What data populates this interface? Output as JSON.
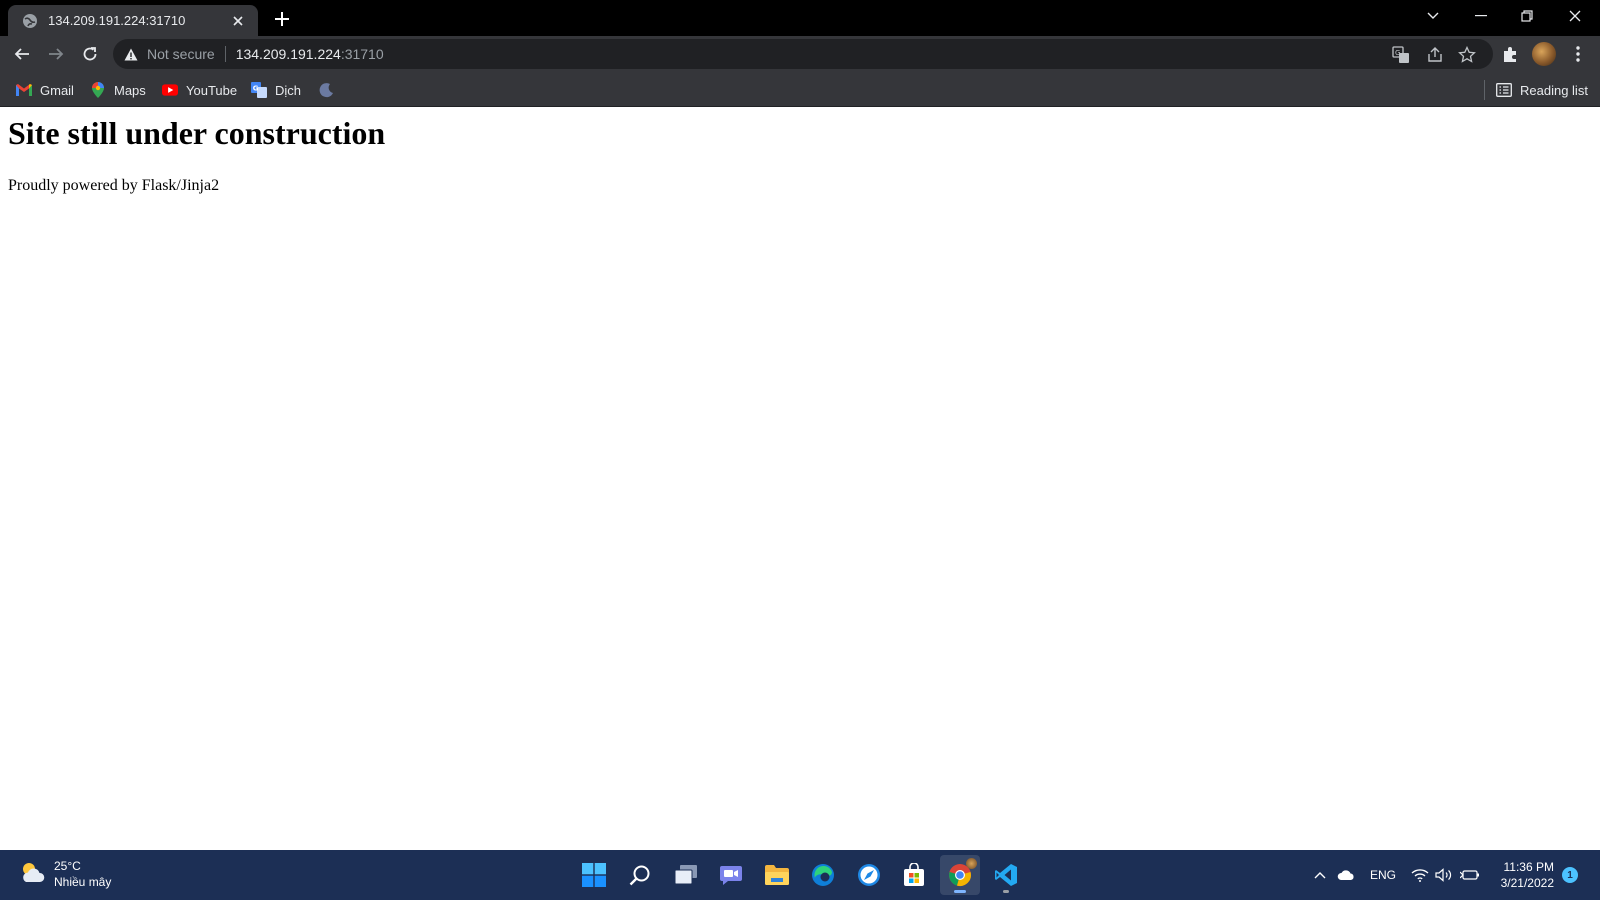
{
  "browser": {
    "tab": {
      "title": "134.209.191.224:31710"
    },
    "address_bar": {
      "security_label": "Not secure",
      "url_host": "134.209.191.224",
      "url_port": ":31710"
    },
    "bookmarks": [
      {
        "label": "Gmail",
        "icon": "gmail-icon"
      },
      {
        "label": "Maps",
        "icon": "maps-icon"
      },
      {
        "label": "YouTube",
        "icon": "youtube-icon"
      },
      {
        "label": "Dịch",
        "icon": "translate-icon"
      }
    ],
    "reading_list_label": "Reading list"
  },
  "page": {
    "heading": "Site still under construction",
    "footer_text": "Proudly powered by Flask/Jinja2"
  },
  "taskbar": {
    "weather": {
      "temperature": "25°C",
      "condition": "Nhiều mây"
    },
    "apps": [
      "start",
      "search",
      "task-view",
      "chat",
      "file-explorer",
      "edge",
      "pinned-app",
      "store",
      "chrome",
      "vscode"
    ],
    "language": "ENG",
    "clock": {
      "time": "11:36 PM",
      "date": "3/21/2022"
    },
    "notification_count": "1"
  },
  "colors": {
    "titlebar": "#000000",
    "toolbar": "#35363a",
    "omnibox": "#202124",
    "taskbar": "#1c2f55"
  }
}
